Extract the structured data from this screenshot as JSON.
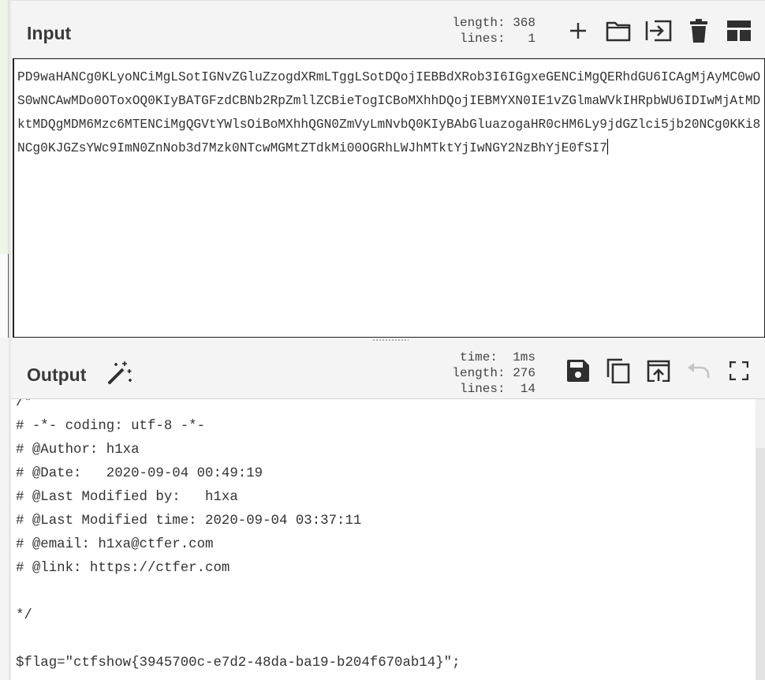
{
  "input": {
    "title": "Input",
    "stats": {
      "length_label": "length:",
      "length_value": "368",
      "lines_label": "lines:",
      "lines_value": "1"
    },
    "text": "PD9waHANCg0KLyoNCiMgLSotIGNvZGluZzogdXRmLTggLSotDQojIEBBdXRob3I6IGgxeGENCiMgQERhdGU6ICAgMjAyMC0wOS0wNCAwMDo0OToxOQ0KIyBATGFzdCBNb2RpZmllZCBieTogICBoMXhhDQojIEBMYXN0IE1vZGlmaWVkIHRpbWU6IDIwMjAtMDktMDQgMDM6Mzc6MTENCiMgQGVtYWlsOiBoMXhhQGN0ZmVyLmNvbQ0KIyBAbGluazogaHR0cHM6Ly9jdGZlci5jb20NCg0KKi8NCg0KJGZsYWc9ImN0ZnNob3d7Mzk0NTcwMGMtZTdkMi00OGRhLWJhMTktYjIwNGY2NzBhYjE0fSI7",
    "icons": [
      "add-icon",
      "open-folder-icon",
      "load-input-icon",
      "trash-icon",
      "layout-icon"
    ]
  },
  "output": {
    "title": "Output",
    "stats": {
      "time_label": "time:",
      "time_value": "1ms",
      "length_label": "length:",
      "length_value": "276",
      "lines_label": "lines:",
      "lines_value": "14"
    },
    "lines": [
      "/*",
      "# -*- coding: utf-8 -*-",
      "# @Author: h1xa",
      "# @Date:   2020-09-04 00:49:19",
      "# @Last Modified by:   h1xa",
      "# @Last Modified time: 2020-09-04 03:37:11",
      "# @email: h1xa@ctfer.com",
      "# @link: https://ctfer.com",
      "",
      "*/",
      "",
      "$flag=\"ctfshow{3945700c-e7d2-48da-ba19-b204f670ab14}\";"
    ],
    "icons": [
      "magic-wand-icon",
      "save-icon",
      "copy-icon",
      "replace-input-icon",
      "undo-icon",
      "fullscreen-icon"
    ]
  },
  "colors": {
    "header_bg": "#f4f4f4",
    "icon": "#2f2f2f",
    "icon_disabled": "#c4c4c4",
    "border": "#222222"
  }
}
